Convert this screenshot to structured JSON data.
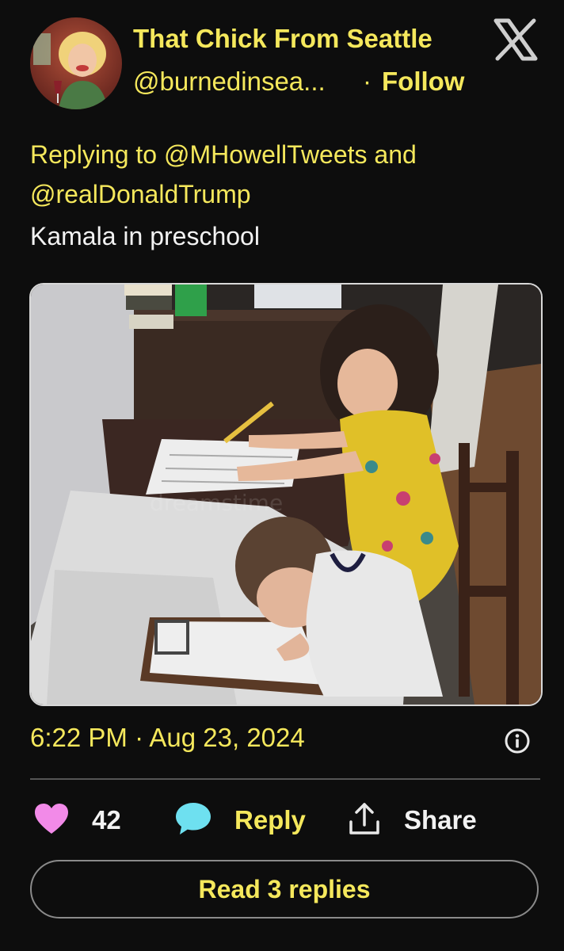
{
  "author": {
    "display_name": "That Chick From Seattle",
    "handle": "@burnedinsea...",
    "separator": "·",
    "follow_label": "Follow"
  },
  "reply_context": {
    "prefix": "Replying to",
    "mention_1": "@MHowellTweets",
    "conjunction": "and",
    "mention_2": "@realDonaldTrump"
  },
  "tweet": {
    "text": "Kamala in preschool",
    "timestamp": "6:22 PM · Aug 23, 2024"
  },
  "actions": {
    "likes_count": "42",
    "reply_label": "Reply",
    "share_label": "Share"
  },
  "read_replies_label": "Read 3 replies",
  "icons": {
    "close": "x-logo-icon",
    "info": "info-icon",
    "like": "heart-icon",
    "reply": "speech-bubble-icon",
    "share": "share-upload-icon"
  },
  "colors": {
    "background": "#0d0d0d",
    "accent_text": "#f5e85c",
    "heart": "#f28ae8",
    "reply_bubble": "#6ee0f0"
  }
}
